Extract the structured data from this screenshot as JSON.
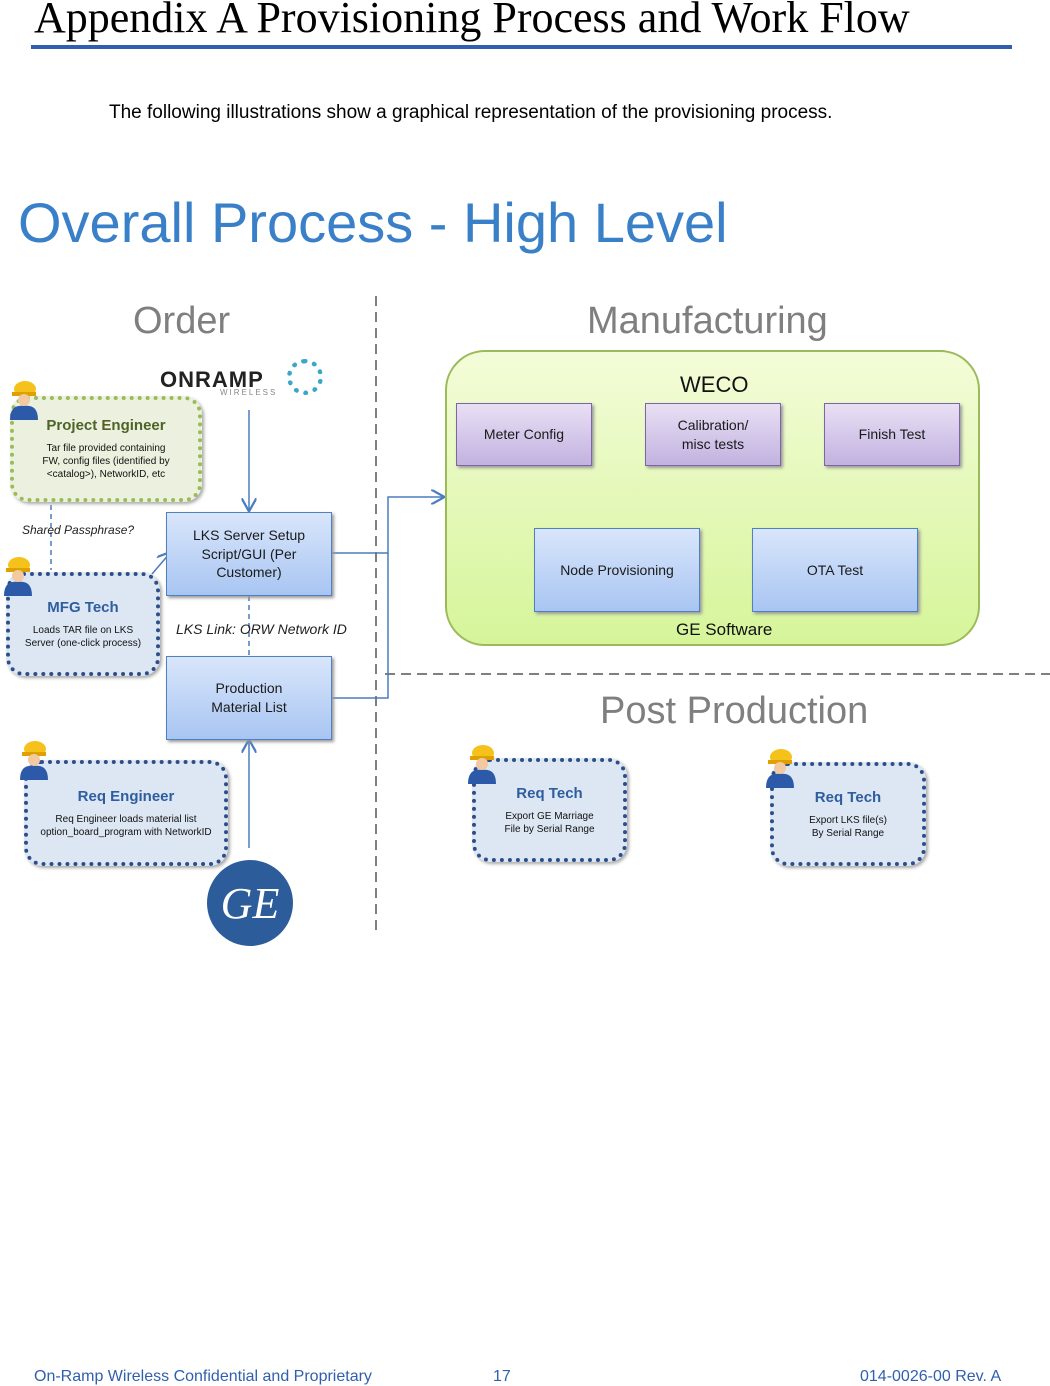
{
  "heading": "Appendix A Provisioning Process and Work Flow",
  "intro": "The following illustrations show a graphical representation of the provisioning process.",
  "diagram": {
    "title": "Overall Process - High Level",
    "sections": {
      "order": "Order",
      "manufacturing": "Manufacturing",
      "post": "Post Production"
    },
    "logos": {
      "onramp": "ONRAMP",
      "onramp_sub": "WIRELESS",
      "ge": "GE"
    },
    "roles": [
      {
        "title": "Project Engineer",
        "desc": "Tar file provided containing FW, config files (identified by <catalog>), NetworkID, etc"
      },
      {
        "title": "MFG Tech",
        "desc": "Loads TAR file on LKS Server (one-click process)"
      },
      {
        "title": "Req Engineer",
        "desc": "Req Engineer loads material list option_board_program with NetworkID"
      },
      {
        "title": "Req Tech",
        "desc": "Export GE Marriage File by Serial Range"
      },
      {
        "title": "Req Tech",
        "desc": "Export LKS file(s) By Serial Range"
      }
    ],
    "labels": {
      "passphrase": "Shared Passphrase?",
      "lkslink": "LKS Link: ORW Network ID",
      "weco": "WECO",
      "gesw": "GE Software"
    },
    "boxes": {
      "lks": "LKS Server Setup Script/GUI (Per Customer)",
      "pml": "Production Material List",
      "meter": "Meter Config",
      "calib": "Calibration/ misc tests",
      "finish": "Finish Test",
      "node": "Node Provisioning",
      "ota": "OTA Test"
    }
  },
  "footer": {
    "left": "On-Ramp Wireless Confidential and Proprietary",
    "page": "17",
    "right": "014-0026-00 Rev. A"
  },
  "colors": {
    "accent": "#2f5fae",
    "title": "#3a80c8"
  }
}
